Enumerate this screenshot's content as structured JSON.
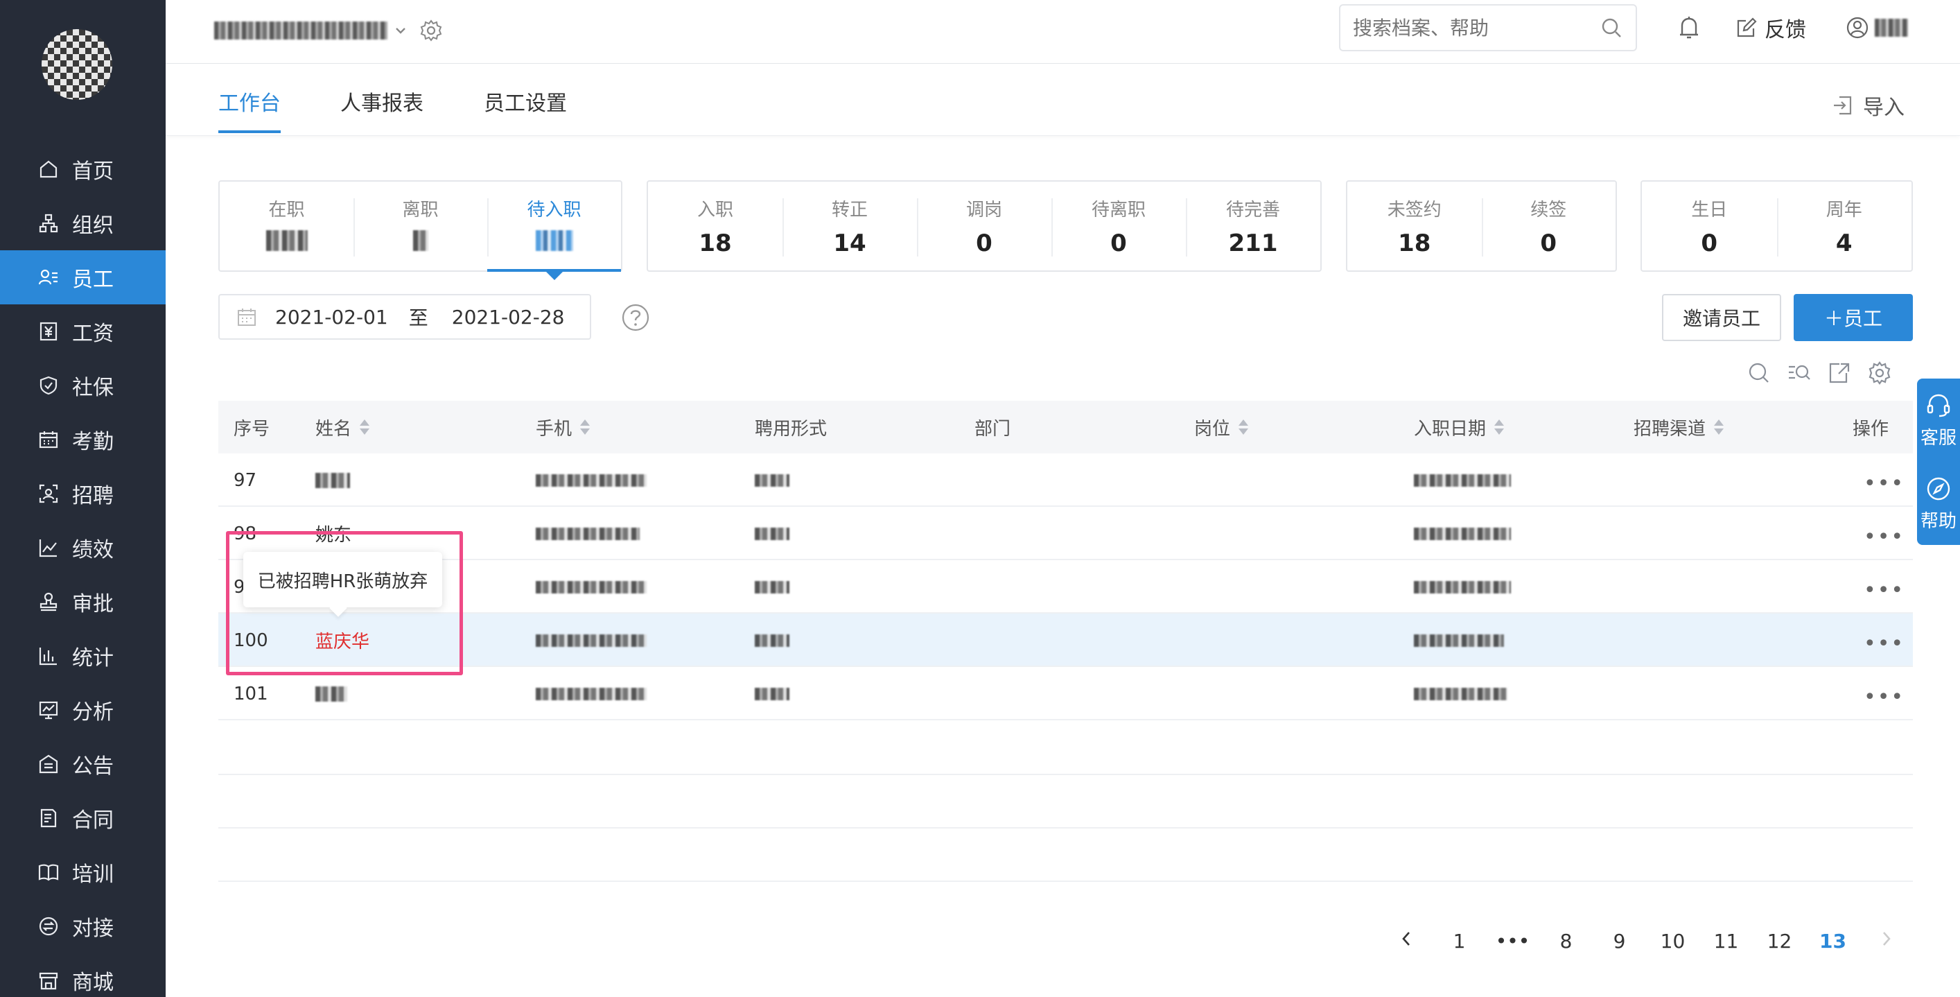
{
  "sidebar": {
    "items": [
      {
        "label": "首页",
        "icon": "home-icon"
      },
      {
        "label": "组织",
        "icon": "org-icon"
      },
      {
        "label": "员工",
        "icon": "employee-icon",
        "active": true
      },
      {
        "label": "工资",
        "icon": "salary-icon"
      },
      {
        "label": "社保",
        "icon": "shield-icon"
      },
      {
        "label": "考勤",
        "icon": "calendar-icon"
      },
      {
        "label": "招聘",
        "icon": "recruit-icon"
      },
      {
        "label": "绩效",
        "icon": "chart-line-icon"
      },
      {
        "label": "审批",
        "icon": "stamp-icon"
      },
      {
        "label": "统计",
        "icon": "bar-chart-icon"
      },
      {
        "label": "分析",
        "icon": "analysis-icon"
      },
      {
        "label": "公告",
        "icon": "notice-icon"
      },
      {
        "label": "合同",
        "icon": "contract-icon"
      },
      {
        "label": "培训",
        "icon": "book-icon"
      },
      {
        "label": "对接",
        "icon": "exchange-icon"
      },
      {
        "label": "商城",
        "icon": "store-icon"
      }
    ]
  },
  "header": {
    "search_placeholder": "搜索档案、帮助",
    "feedback": "反馈"
  },
  "tabs": [
    "工作台",
    "人事报表",
    "员工设置"
  ],
  "import_label": "导入",
  "stat_groups": [
    [
      {
        "label": "在职",
        "value": ""
      },
      {
        "label": "离职",
        "value": ""
      },
      {
        "label": "待入职",
        "value": "",
        "active": true
      }
    ],
    [
      {
        "label": "入职",
        "value": "18"
      },
      {
        "label": "转正",
        "value": "14"
      },
      {
        "label": "调岗",
        "value": "0"
      },
      {
        "label": "待离职",
        "value": "0"
      },
      {
        "label": "待完善",
        "value": "211"
      }
    ],
    [
      {
        "label": "未签约",
        "value": "18"
      },
      {
        "label": "续签",
        "value": "0"
      }
    ],
    [
      {
        "label": "生日",
        "value": "0"
      },
      {
        "label": "周年",
        "value": "4"
      }
    ]
  ],
  "date_range": {
    "start": "2021-02-01",
    "sep": "至",
    "end": "2021-02-28"
  },
  "buttons": {
    "invite": "邀请员工",
    "add": "＋员工"
  },
  "table": {
    "headers": [
      "序号",
      "姓名",
      "手机",
      "聘用形式",
      "部门",
      "岗位",
      "入职日期",
      "招聘渠道",
      "操作"
    ],
    "rows": [
      {
        "no": "97",
        "name": "",
        "highlight": false
      },
      {
        "no": "98",
        "name": "姚东",
        "highlight": false
      },
      {
        "no": "9",
        "name": "",
        "highlight": false
      },
      {
        "no": "100",
        "name": "蓝庆华",
        "highlight": true
      },
      {
        "no": "101",
        "name": "",
        "highlight": false
      }
    ],
    "more": "•••"
  },
  "tooltip": "已被招聘HR张萌放弃",
  "pagination": [
    "1",
    "•••",
    "8",
    "9",
    "10",
    "11",
    "12",
    "13"
  ],
  "current_page": "13",
  "float": {
    "service": "客服",
    "help": "帮助"
  },
  "colors": {
    "primary": "#2b88d8",
    "sidebar": "#262c38",
    "highlight_box": "#ef4a86",
    "name_red": "#e02e2e"
  }
}
